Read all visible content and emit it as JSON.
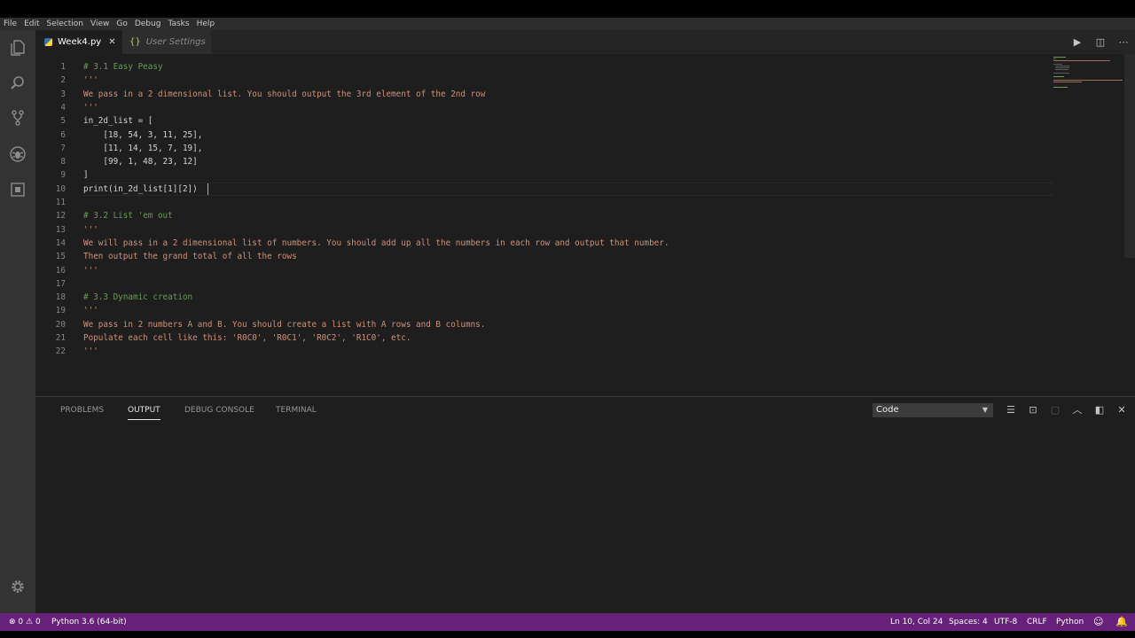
{
  "menu": [
    "File",
    "Edit",
    "Selection",
    "View",
    "Go",
    "Debug",
    "Tasks",
    "Help"
  ],
  "tabs": [
    {
      "label": "Week4.py",
      "active": true
    },
    {
      "label": "User Settings",
      "active": false
    }
  ],
  "icons": {
    "explorer": "files-icon",
    "search": "search-icon",
    "scm": "source-control-icon",
    "debug": "debug-icon",
    "extensions": "extensions-icon",
    "settings": "gear-icon",
    "run": "play-icon",
    "split": "split-editor-icon",
    "more": "more-icon"
  },
  "editor": {
    "lines": [
      {
        "num": "1",
        "text": "# 3.1 Easy Peasy",
        "kind": "comment"
      },
      {
        "num": "2",
        "text": "'''",
        "kind": "string"
      },
      {
        "num": "3",
        "text": "We pass in a 2 dimensional list. You should output the 3rd element of the 2nd row",
        "kind": "string"
      },
      {
        "num": "4",
        "text": "'''",
        "kind": "string"
      },
      {
        "num": "5",
        "text": "in_2d_list = [",
        "kind": "plain"
      },
      {
        "num": "6",
        "text": "    [18, 54, 3, 11, 25],",
        "kind": "plain"
      },
      {
        "num": "7",
        "text": "    [11, 14, 15, 7, 19],",
        "kind": "plain"
      },
      {
        "num": "8",
        "text": "    [99, 1, 48, 23, 12]",
        "kind": "plain"
      },
      {
        "num": "9",
        "text": "]",
        "kind": "plain"
      },
      {
        "num": "10",
        "text": "print(in_2d_list[1][2])",
        "kind": "plain"
      },
      {
        "num": "11",
        "text": "",
        "kind": "plain"
      },
      {
        "num": "12",
        "text": "# 3.2 List 'em out",
        "kind": "comment"
      },
      {
        "num": "13",
        "text": "'''",
        "kind": "string"
      },
      {
        "num": "14",
        "text": "We will pass in a 2 dimensional list of numbers. You should add up all the numbers in each row and output that number.",
        "kind": "string"
      },
      {
        "num": "15",
        "text": "Then output the grand total of all the rows",
        "kind": "string"
      },
      {
        "num": "16",
        "text": "'''",
        "kind": "string"
      },
      {
        "num": "17",
        "text": "",
        "kind": "plain"
      },
      {
        "num": "18",
        "text": "# 3.3 Dynamic creation",
        "kind": "comment"
      },
      {
        "num": "19",
        "text": "'''",
        "kind": "string"
      },
      {
        "num": "20",
        "text": "We pass in 2 numbers A and B. You should create a list with A rows and B columns.",
        "kind": "string"
      },
      {
        "num": "21",
        "text": "Populate each cell like this: 'R0C0', 'R0C1', 'R0C2', 'R1C0', etc.",
        "kind": "string"
      },
      {
        "num": "22",
        "text": "'''",
        "kind": "string"
      }
    ]
  },
  "panel": {
    "tabs": [
      "PROBLEMS",
      "OUTPUT",
      "DEBUG CONSOLE",
      "TERMINAL"
    ],
    "active_tab": "OUTPUT",
    "output_channel": "Code"
  },
  "status": {
    "errors": "0",
    "warnings": "0",
    "interpreter": "Python 3.6 (64-bit)",
    "position": "Ln 10, Col 24",
    "spaces": "Spaces: 4",
    "encoding": "UTF-8",
    "eol": "CRLF",
    "language": "Python"
  },
  "colors": {
    "statusbar": "#68217a",
    "comment": "#6a9955",
    "string": "#ce9178",
    "editor_bg": "#1e1e1e"
  }
}
